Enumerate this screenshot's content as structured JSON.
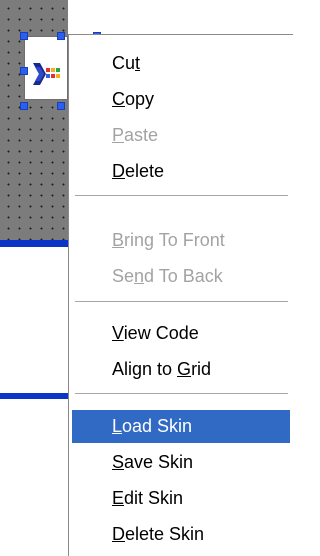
{
  "colors": {
    "canvas_bg": "#7c7c7c",
    "selection_blue": "#316ac5",
    "handle_blue": "#2a5ff0",
    "disabled_text": "#a3a3a3",
    "guide_line_blue": "#0a35c8"
  },
  "designer": {
    "selected_control_icon": "arrow-logo-icon"
  },
  "context_menu": {
    "cut": {
      "before": "Cu",
      "accel": "t",
      "after": ""
    },
    "copy": {
      "before": "",
      "accel": "C",
      "after": "opy"
    },
    "paste": {
      "before": "",
      "accel": "P",
      "after": "aste"
    },
    "delete": {
      "before": "",
      "accel": "D",
      "after": "elete"
    },
    "bring_to_front": {
      "before": "",
      "accel": "B",
      "after": "ring To Front"
    },
    "send_to_back": {
      "before": "Se",
      "accel": "n",
      "after": "d To Back"
    },
    "view_code": {
      "before": "",
      "accel": "V",
      "after": "iew Code"
    },
    "align_to_grid": {
      "before": "Align to ",
      "accel": "G",
      "after": "rid"
    },
    "load_skin": {
      "before": "",
      "accel": "L",
      "after": "oad Skin"
    },
    "save_skin": {
      "before": "",
      "accel": "S",
      "after": "ave Skin"
    },
    "edit_skin": {
      "before": "",
      "accel": "E",
      "after": "dit Skin"
    },
    "delete_skin": {
      "before": "",
      "accel": "D",
      "after": "elete Skin"
    }
  }
}
